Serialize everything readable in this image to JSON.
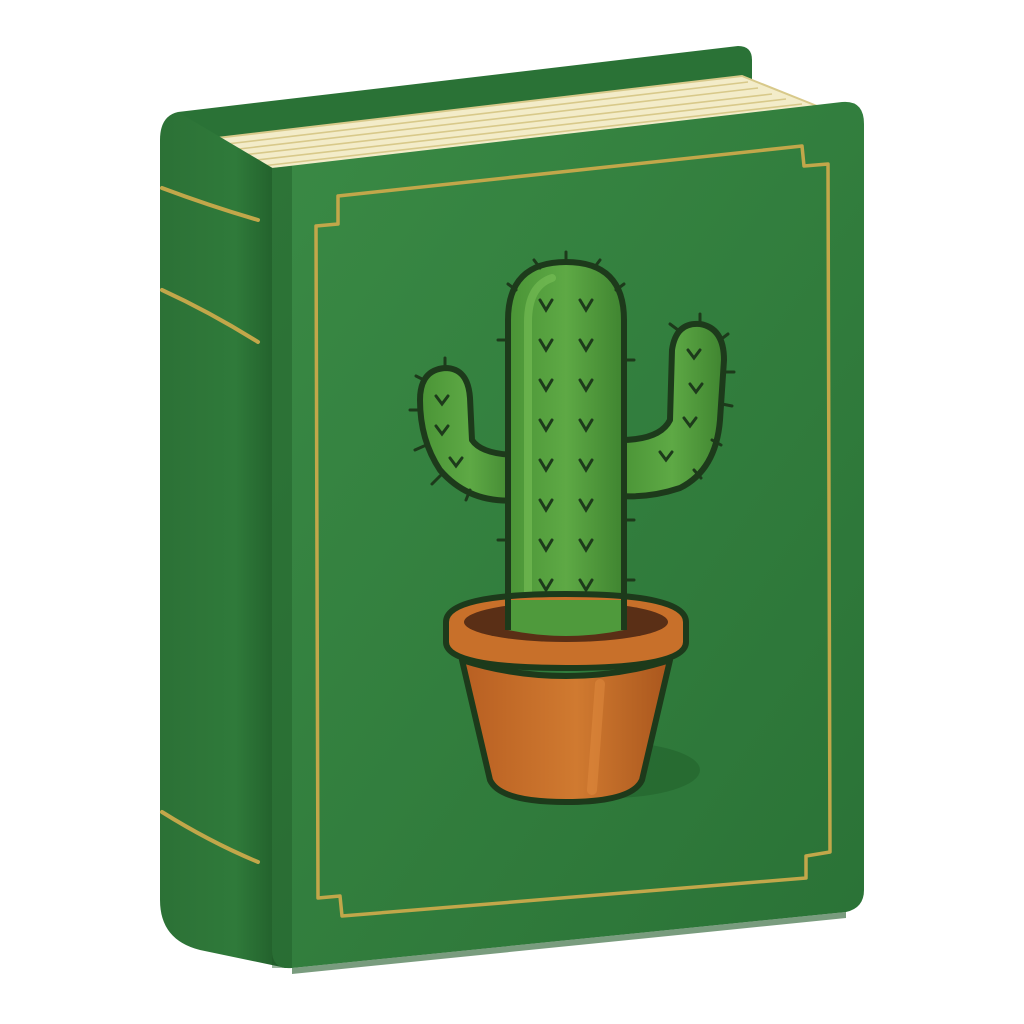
{
  "illustration": {
    "subject": "book-icon",
    "cover_icon": "potted-cactus-icon"
  },
  "colors": {
    "background": "#ffffff",
    "cover_green": "#2f7d3b",
    "cover_green_dark": "#1f5e2a",
    "spine_green": "#2a6f34",
    "gold_trim": "#c2a74a",
    "pages": "#f3ecc9",
    "page_lines": "#d8c98a",
    "cactus_green": "#4f9a3c",
    "cactus_light": "#6fb64f",
    "cactus_outline": "#1d3a1b",
    "pot_orange": "#c8702a",
    "pot_dark": "#a9561d",
    "soil": "#5a2f16"
  }
}
